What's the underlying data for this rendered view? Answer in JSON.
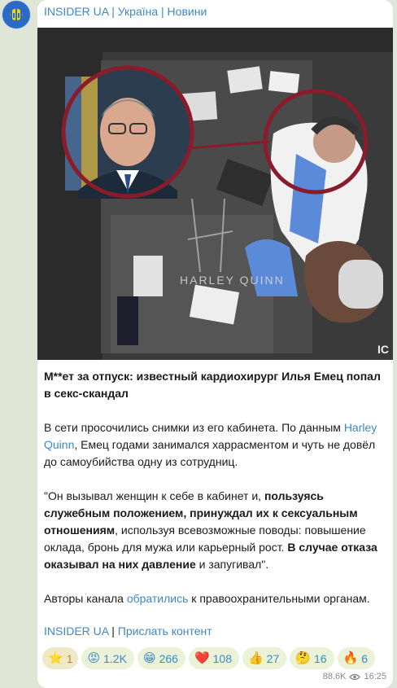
{
  "channel": {
    "name": "INSIDER UA | Україна | Новини"
  },
  "media": {
    "watermark": "HARLEY QUINN",
    "corner_text": "IC"
  },
  "post": {
    "title": "М**ет за отпуск: известный кардиохирург Илья Емец попал в секс-скандал",
    "p2_a": "В сети просочились снимки из его кабинета. По данным ",
    "p2_link": "Harley Quinn",
    "p2_b": ", Емец годами занимался харрасментом и чуть не довёл до самоубийства одну из сотрудниц.",
    "p3_a": "\"Он вызывал женщин к себе в кабинет и, ",
    "p3_b": "пользуясь служебным положением, принуждал их к сексуальным отношениям",
    "p3_c": ", используя всевозможные поводы: повышение оклада, бронь для мужа или карьерный рост. ",
    "p3_d": "В случае отказа оказывал на них давление",
    "p3_e": " и запугивал\".",
    "p4_a": "Авторы канала ",
    "p4_link": "обратились",
    "p4_b": " к правоохранительными органам."
  },
  "footer": {
    "link1": "INSIDER UA",
    "sep": " | ",
    "link2": "Прислать контент"
  },
  "reactions": [
    {
      "emoji": "⭐",
      "count": "1"
    },
    {
      "emoji": "😡",
      "count": "1.2K"
    },
    {
      "emoji": "😁",
      "count": "266"
    },
    {
      "emoji": "❤️",
      "count": "108"
    },
    {
      "emoji": "👍",
      "count": "27"
    },
    {
      "emoji": "🤔",
      "count": "16"
    },
    {
      "emoji": "🔥",
      "count": "6"
    }
  ],
  "meta": {
    "views": "88.6K",
    "time": "16:25"
  },
  "colors": {
    "link": "#3f88c5",
    "bubble": "#ffffff",
    "background": "#dfe6d5",
    "circle": "#8a1b2a"
  }
}
